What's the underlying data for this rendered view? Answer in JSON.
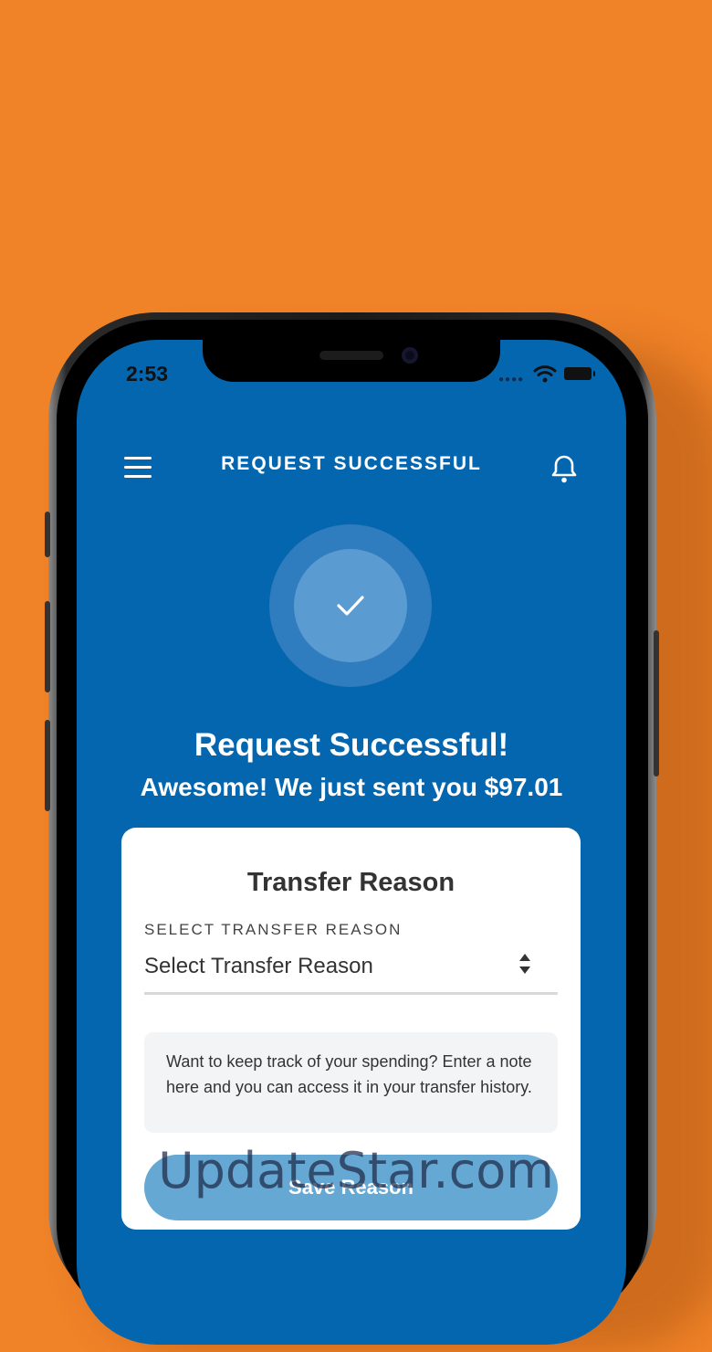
{
  "status_bar": {
    "time": "2:53"
  },
  "header": {
    "title": "REQUEST SUCCESSFUL"
  },
  "success": {
    "headline": "Request Successful!",
    "message": "Awesome! We just sent you $97.01"
  },
  "card": {
    "title": "Transfer Reason",
    "select_label": "SELECT TRANSFER REASON",
    "select_value": "Select Transfer Reason",
    "note_placeholder": "Want to keep track of your spending? Enter a note here and you can access it in your transfer history.",
    "save_label": "Save Reason"
  },
  "watermark": "UpdateStar.com",
  "colors": {
    "background": "#F08228",
    "screen": "#0466AE",
    "button": "#66A8D4"
  }
}
